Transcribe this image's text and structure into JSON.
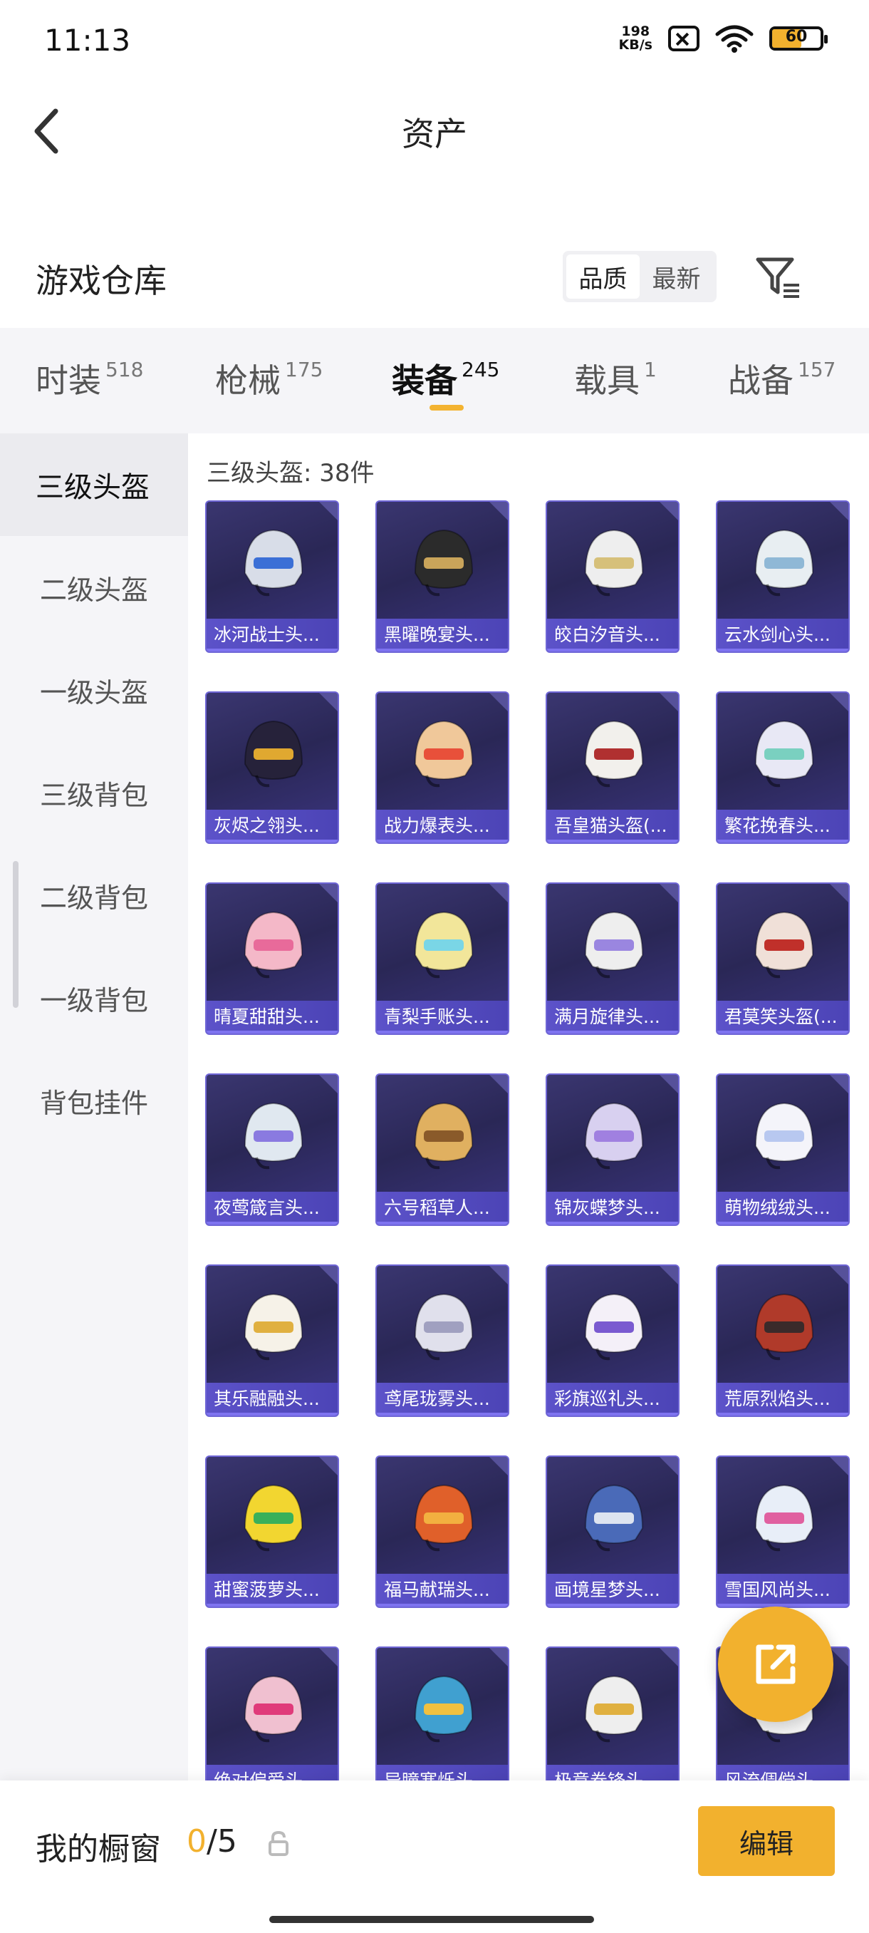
{
  "status_bar": {
    "time": "11:13",
    "net_speed_value": "198",
    "net_speed_unit": "KB/s",
    "battery": "60",
    "battery_fill_percent": 60
  },
  "header": {
    "title": "资产"
  },
  "warehouse": {
    "title": "游戏仓库",
    "sort_options": [
      "品质",
      "最新"
    ],
    "sort_selected": "品质"
  },
  "tabs": [
    {
      "label": "时装",
      "count": "518",
      "active": false
    },
    {
      "label": "枪械",
      "count": "175",
      "active": false
    },
    {
      "label": "装备",
      "count": "245",
      "active": true
    },
    {
      "label": "载具",
      "count": "1",
      "active": false
    },
    {
      "label": "战备",
      "count": "157",
      "active": false
    }
  ],
  "sidebar": {
    "items": [
      {
        "label": "三级头盔",
        "active": true
      },
      {
        "label": "二级头盔",
        "active": false
      },
      {
        "label": "一级头盔",
        "active": false
      },
      {
        "label": "三级背包",
        "active": false
      },
      {
        "label": "二级背包",
        "active": false
      },
      {
        "label": "一级背包",
        "active": false
      },
      {
        "label": "背包挂件",
        "active": false
      }
    ]
  },
  "content": {
    "section_title": "三级头盔: 38件",
    "items": [
      {
        "name": "冰河战士头...",
        "color": "#d8dde8",
        "accent": "#3b6fd6"
      },
      {
        "name": "黑曜晚宴头...",
        "color": "#2b2b2b",
        "accent": "#c9a45a"
      },
      {
        "name": "皎白汐音头...",
        "color": "#eeeeee",
        "accent": "#d6c07a"
      },
      {
        "name": "云水剑心头...",
        "color": "#e8eef2",
        "accent": "#8fb8d6"
      },
      {
        "name": "灰烬之翎头...",
        "color": "#26223a",
        "accent": "#e0a830"
      },
      {
        "name": "战力爆表头...",
        "color": "#f0c89a",
        "accent": "#e8503a"
      },
      {
        "name": "吾皇猫头盔(...",
        "color": "#f2f0ec",
        "accent": "#b03030"
      },
      {
        "name": "繁花挽春头...",
        "color": "#e8e8f5",
        "accent": "#7ad0c0"
      },
      {
        "name": "晴夏甜甜头...",
        "color": "#f4b8c8",
        "accent": "#e86a9a"
      },
      {
        "name": "青梨手账头...",
        "color": "#f2e69a",
        "accent": "#7ad6e6"
      },
      {
        "name": "满月旋律头...",
        "color": "#eeeeee",
        "accent": "#9a86e0"
      },
      {
        "name": "君莫笑头盔(...",
        "color": "#f0e0d8",
        "accent": "#c0302a"
      },
      {
        "name": "夜莺箴言头...",
        "color": "#e0e8f0",
        "accent": "#8a7ae0"
      },
      {
        "name": "六号稻草人...",
        "color": "#e0b060",
        "accent": "#8a5a2a"
      },
      {
        "name": "锦灰蝶梦头...",
        "color": "#d8d0f0",
        "accent": "#a080e0"
      },
      {
        "name": "萌物绒绒头...",
        "color": "#f4f4fa",
        "accent": "#b8c8f0"
      },
      {
        "name": "其乐融融头...",
        "color": "#f6f2e8",
        "accent": "#e0b040"
      },
      {
        "name": "鸢尾珑雾头...",
        "color": "#e0e0ec",
        "accent": "#a0a0c0"
      },
      {
        "name": "彩旗巡礼头...",
        "color": "#f4f0f8",
        "accent": "#7a5ad0"
      },
      {
        "name": "荒原烈焰头...",
        "color": "#b03a2a",
        "accent": "#3a2a2a"
      },
      {
        "name": "甜蜜菠萝头...",
        "color": "#f2d630",
        "accent": "#3ab05a"
      },
      {
        "name": "福马献瑞头...",
        "color": "#e0602a",
        "accent": "#f2b040"
      },
      {
        "name": "画境星梦头...",
        "color": "#4a6ab8",
        "accent": "#dde4f0"
      },
      {
        "name": "雪国风尚头...",
        "color": "#e8eef8",
        "accent": "#e060a0"
      },
      {
        "name": "绝对偏爱头...",
        "color": "#f0c0d0",
        "accent": "#e03a7a"
      },
      {
        "name": "异瞳寒烁头...",
        "color": "#40a0d0",
        "accent": "#f0c040"
      },
      {
        "name": "极意卷锋头...",
        "color": "#eeeeee",
        "accent": "#e0b040"
      },
      {
        "name": "风流倜傥头...",
        "color": "#f4f4f4",
        "accent": "#c0c0d0"
      }
    ]
  },
  "bottom_bar": {
    "showcase_label": "我的橱窗",
    "showcase_current": "0",
    "showcase_sep_total": "/5",
    "edit_label": "编辑"
  },
  "icons": {
    "back": "chevron-left-icon",
    "filter": "filter-icon",
    "share": "share-external-icon",
    "lock": "lock-icon"
  },
  "colors": {
    "accent": "#f2b12e",
    "card_bg": "#2f2b63",
    "card_label": "#5c52c9"
  }
}
